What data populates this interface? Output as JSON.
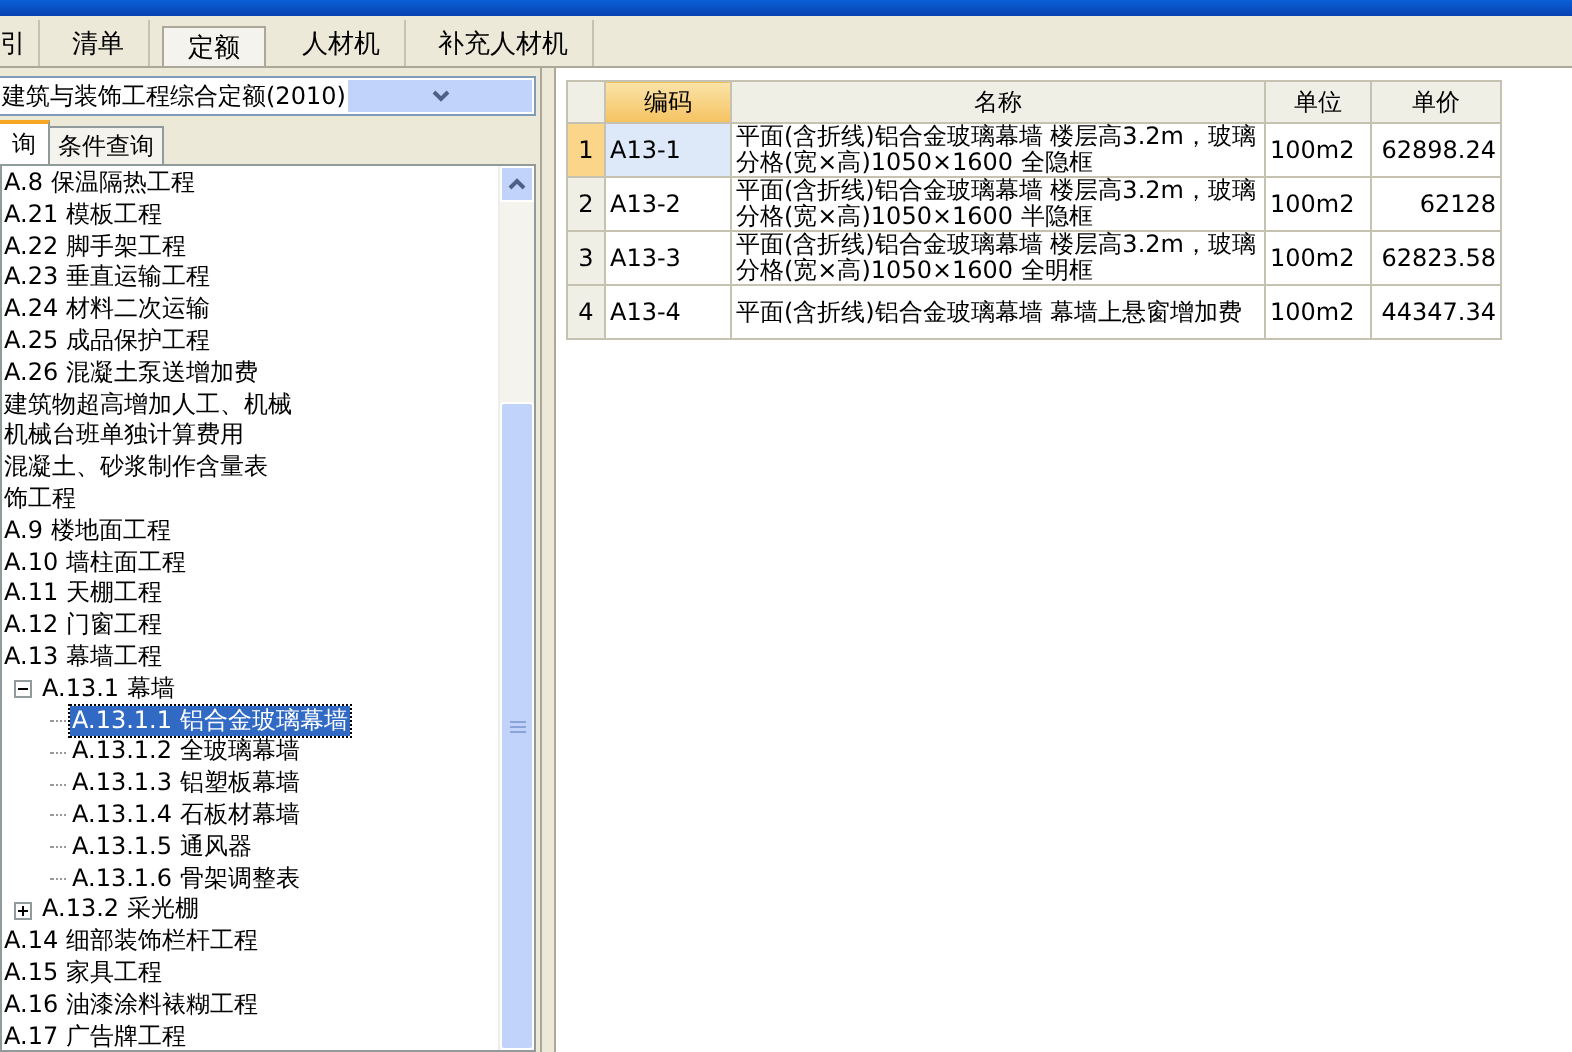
{
  "top_tabs": [
    {
      "label": "引",
      "selected": false
    },
    {
      "label": "清单",
      "selected": false
    },
    {
      "label": "定额",
      "selected": true
    },
    {
      "label": "人材机",
      "selected": false
    },
    {
      "label": "补充人材机",
      "selected": false
    }
  ],
  "quota_select": {
    "value": "建筑与装饰工程综合定额(2010)"
  },
  "query_tabs": [
    {
      "label": "询",
      "selected": true
    },
    {
      "label": "条件查询",
      "selected": false
    }
  ],
  "tree": [
    {
      "label": "A.8 保温隔热工程",
      "selected": false
    },
    {
      "label": "A.21 模板工程",
      "selected": false
    },
    {
      "label": "A.22 脚手架工程",
      "selected": false
    },
    {
      "label": "A.23 垂直运输工程",
      "selected": false
    },
    {
      "label": "A.24 材料二次运输",
      "selected": false
    },
    {
      "label": "A.25 成品保护工程",
      "selected": false
    },
    {
      "label": "A.26 混凝土泵送增加费",
      "selected": false
    },
    {
      "label": "建筑物超高增加人工、机械",
      "selected": false
    },
    {
      "label": "机械台班单独计算费用",
      "selected": false
    },
    {
      "label": "混凝土、砂浆制作含量表",
      "selected": false
    },
    {
      "label": "饰工程",
      "selected": false
    },
    {
      "label": "A.9 楼地面工程",
      "selected": false
    },
    {
      "label": "A.10 墙柱面工程",
      "selected": false
    },
    {
      "label": "A.11 天棚工程",
      "selected": false
    },
    {
      "label": "A.12 门窗工程",
      "selected": false
    },
    {
      "label": "A.13 幕墙工程",
      "selected": false,
      "children": [
        {
          "label": "A.13.1 幕墙",
          "selected": false,
          "expanded": true,
          "children": [
            {
              "label": "A.13.1.1 铝合金玻璃幕墙",
              "selected": true
            },
            {
              "label": "A.13.1.2 全玻璃幕墙",
              "selected": false
            },
            {
              "label": "A.13.1.3 铝塑板幕墙",
              "selected": false
            },
            {
              "label": "A.13.1.4 石板材幕墙",
              "selected": false
            },
            {
              "label": "A.13.1.5 通风器",
              "selected": false
            },
            {
              "label": "A.13.1.6 骨架调整表",
              "selected": false
            }
          ]
        },
        {
          "label": "A.13.2 采光棚",
          "selected": false,
          "expanded": false
        }
      ]
    },
    {
      "label": "A.14 细部装饰栏杆工程",
      "selected": false
    },
    {
      "label": "A.15 家具工程",
      "selected": false
    },
    {
      "label": "A.16 油漆涂料裱糊工程",
      "selected": false
    },
    {
      "label": "A.17 广告牌工程",
      "selected": false
    }
  ],
  "table": {
    "columns": [
      "编码",
      "名称",
      "单位",
      "单价"
    ],
    "rows": [
      {
        "index": "1",
        "selected": true,
        "code": "A13-1",
        "name": "平面(含折线)铝合金玻璃幕墙 楼层高3.2m，玻璃分格(宽×高)1050×1600 全隐框",
        "unit": "100m2",
        "price": "62898.24"
      },
      {
        "index": "2",
        "selected": false,
        "code": "A13-2",
        "name": "平面(含折线)铝合金玻璃幕墙 楼层高3.2m，玻璃分格(宽×高)1050×1600 半隐框",
        "unit": "100m2",
        "price": "62128"
      },
      {
        "index": "3",
        "selected": false,
        "code": "A13-3",
        "name": "平面(含折线)铝合金玻璃幕墙 楼层高3.2m，玻璃分格(宽×高)1050×1600 全明框",
        "unit": "100m2",
        "price": "62823.58"
      },
      {
        "index": "4",
        "selected": false,
        "code": "A13-4",
        "name": "平面(含折线)铝合金玻璃幕墙 幕墙上悬窗增加费",
        "unit": "100m2",
        "price": "44347.34"
      }
    ]
  }
}
